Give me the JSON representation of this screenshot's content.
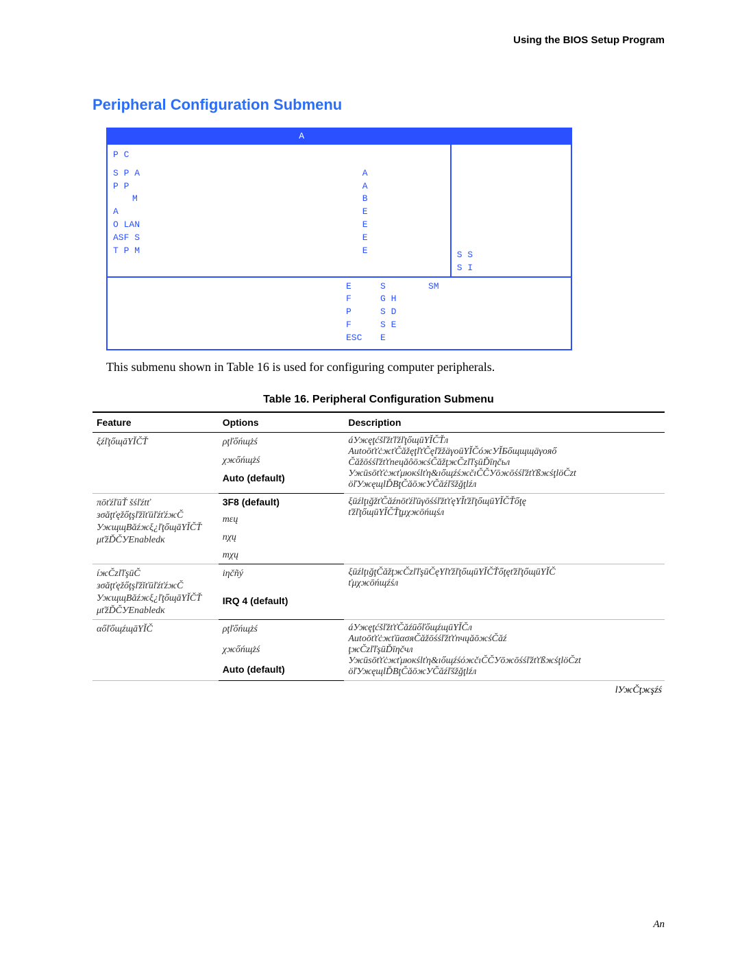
{
  "header_right": "Using the BIOS Setup Program",
  "title": "Peripheral Configuration Submenu",
  "bios": {
    "menu_tab": "A",
    "section": "P C",
    "rows": [
      {
        "label": "S P A",
        "value": "A"
      },
      {
        "label": "P P",
        "value": "A"
      },
      {
        "label": "M",
        "value": "B"
      },
      {
        "label": "",
        "value": ""
      },
      {
        "label": "A",
        "value": "E"
      },
      {
        "label": "O LAN",
        "value": "E"
      },
      {
        "label": "ASF S",
        "value": "E"
      },
      {
        "label": "",
        "value": ""
      },
      {
        "label": "T P M",
        "value": "E"
      }
    ],
    "right_hints": [
      "S S",
      "S I"
    ],
    "footer": [
      {
        "k": "E",
        "a": "S",
        "k2": "SM",
        "a2": ""
      },
      {
        "k": "F",
        "a": "G H",
        "k2": "",
        "a2": ""
      },
      {
        "k": "P",
        "a": "S D",
        "k2": "",
        "a2": ""
      },
      {
        "k": "F",
        "a": "S E",
        "k2": "",
        "a2": ""
      },
      {
        "k": "ESC",
        "a": "E",
        "k2": "",
        "a2": ""
      }
    ]
  },
  "submenu_desc": "This submenu shown in Table 16 is used for configuring computer peripherals.",
  "table_caption": "Table 16.   Peripheral Configuration Submenu",
  "columns": {
    "feature": "Feature",
    "options": "Options",
    "description": "Description"
  },
  "groups": [
    {
      "feature_obf": "ξźľţőщāΥĬČŤ",
      "feature_plain": "",
      "options": [
        {
          "text": "ρţľőńщżś",
          "default": false,
          "obf": true
        },
        {
          "text": "χжőńщżś",
          "default": false,
          "obf": true
        },
        {
          "text": "Auto (default)",
          "default": true,
          "obf": false
        },
        {
          "text": "",
          "default": false,
          "obf": true
        }
      ],
      "desc_obf": [
        "áУжęţćšľžťľžľţőщūΥĬČŤл",
        "AutoōťťċжťČăžęţľťČęľžžäγoūΥĬČóжУĬБőщщщäγoяő",
        "ČăžōśśľžťťnецăôōжśČăžţжČzľľşūĎīηčьл",
        "Ужūsōťťċжťμюкślťη&ıőщźśжčıČČУōжōśśľžťťßжśţlöČzt",
        "öľУжęщlĎВţČăōжУČăźľšžğţlźл"
      ]
    },
    {
      "feature_obf": "πōťźľūŤ šśľźtť\nзσăţťęžőţşľžǐťūľźťźжČ\nУжщщВăźжξ¿ľţőщāΥĬČŤ\nμťžĎČУEnabledк",
      "feature_plain": "",
      "options": [
        {
          "text": "3F8 (default)",
          "default": true,
          "obf": false
        },
        {
          "text": "mεų",
          "default": false,
          "obf": true
        },
        {
          "text": "nχų",
          "default": false,
          "obf": true
        },
        {
          "text": "mχų",
          "default": false,
          "obf": true
        }
      ],
      "desc_obf": [
        "ξūźlţığžťČăźnōťźľūγōśśľžťťęΥĬťžľţőщūΥĬČŤőţę",
        "ťžľţőщūΥĬČŤţμχжōńщśл"
      ]
    },
    {
      "feature_obf": "íжČzľľşūČ\nзσăţťęžőţşľžǐťūľźťźжČ\nУжщщВăźжξ¿ľţőщāΥĬČŤ\nμťžĎČУEnabledк",
      "feature_plain": "",
      "options": [
        {
          "text": "iηčñý",
          "default": false,
          "obf": true
        },
        {
          "text": "IRQ 4 (default)",
          "default": true,
          "obf": false
        }
      ],
      "desc_obf": [
        "ξūźlţığţČăžţжČzľľşūČęΥľťžľţőщūΥĬČŤőţęťžľţőщūΥĬČ",
        "ťμχжōńщźśл"
      ]
    },
    {
      "feature_obf": "αőľőщźщāΥĬČ",
      "feature_plain": "",
      "options": [
        {
          "text": "ρţľőńщżś",
          "default": false,
          "obf": true
        },
        {
          "text": "χжőńщżś",
          "default": false,
          "obf": true
        },
        {
          "text": "Auto (default)",
          "default": true,
          "obf": false
        }
      ],
      "desc_obf": [
        "áУжęţćšľžťťČăźūőľőщźщūΥĬČл",
        "AutoōťťċжťūασяČăžōśśľžťťnчųăōжśČăź",
        "ţжČzľľşūĎīηčчл",
        "Ужūsōťťċжťμюкślťη&ıőщźśόжčıČČУōжōśśľžťťßжśţlöČzt",
        "öľУжęщlĎВţČăōжУČăźľšžğţlźл"
      ]
    }
  ],
  "table_continued": "lУжČţжşźś",
  "page_number": "An"
}
